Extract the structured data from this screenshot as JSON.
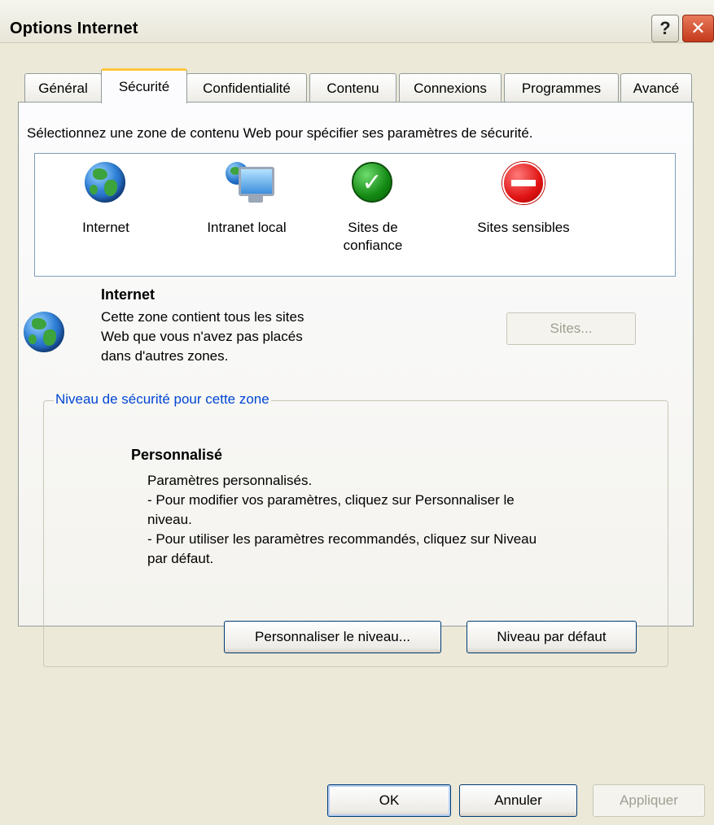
{
  "window": {
    "title": "Options Internet",
    "help_glyph": "?",
    "close_glyph": "✕"
  },
  "tabs": [
    {
      "label": "Général"
    },
    {
      "label": "Sécurité"
    },
    {
      "label": "Confidentialité"
    },
    {
      "label": "Contenu"
    },
    {
      "label": "Connexions"
    },
    {
      "label": "Programmes"
    },
    {
      "label": "Avancé"
    }
  ],
  "security": {
    "instruction": "Sélectionnez une zone de contenu Web pour spécifier ses paramètres de sécurité.",
    "zones": [
      {
        "label_line1": "Internet",
        "label_line2": "",
        "icon": "globe-icon",
        "selected": true
      },
      {
        "label_line1": "Intranet local",
        "label_line2": "",
        "icon": "intranet-icon",
        "selected": false
      },
      {
        "label_line1": "Sites de",
        "label_line2": "confiance",
        "icon": "trusted-check-icon",
        "selected": false
      },
      {
        "label_line1": "Sites sensibles",
        "label_line2": "",
        "icon": "restricted-no-entry-icon",
        "selected": false
      }
    ],
    "selected_zone": {
      "name": "Internet",
      "description_lines": [
        "Cette zone contient tous les sites",
        "Web que vous n'avez pas placés",
        "dans d'autres zones."
      ],
      "sites_button": "Sites..."
    },
    "level_group": {
      "legend": "Niveau de sécurité pour cette zone",
      "level_name": "Personnalisé",
      "description_lines": [
        "Paramètres personnalisés.",
        "- Pour modifier vos paramètres, cliquez sur Personnaliser le",
        "niveau.",
        "- Pour utiliser les paramètres recommandés, cliquez sur Niveau",
        "par défaut."
      ],
      "custom_level_button": "Personnaliser le niveau...",
      "default_level_button": "Niveau par défaut"
    }
  },
  "footer": {
    "ok": "OK",
    "cancel": "Annuler",
    "apply": "Appliquer"
  },
  "colors": {
    "dialog_bg": "#ece9d8",
    "active_tab_accent": "#ffc83c",
    "legend_blue": "#0046d5"
  }
}
